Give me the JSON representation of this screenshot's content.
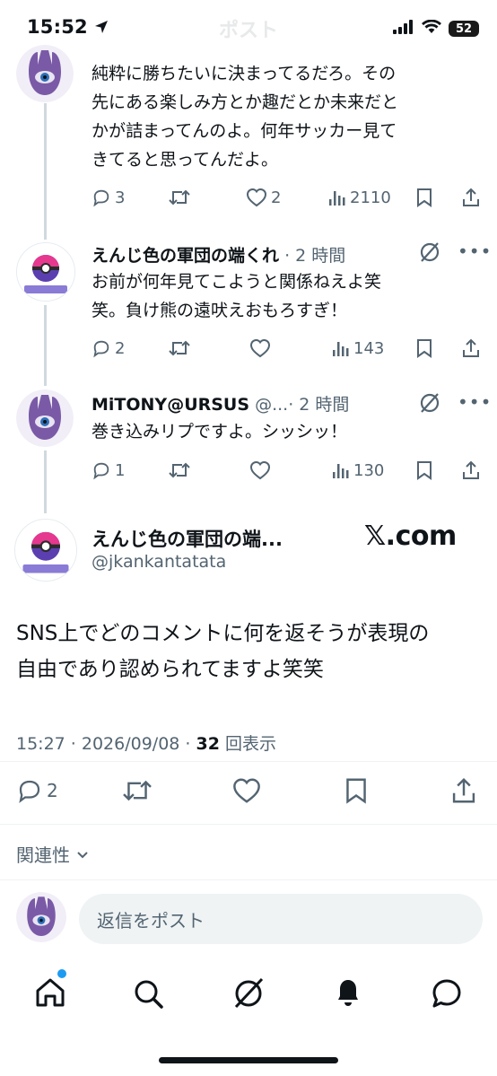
{
  "status_bar": {
    "time": "15:52",
    "battery": "52",
    "title": "ポスト"
  },
  "colors": {
    "accent": "#1d9bf0",
    "muted": "#536471",
    "line": "#cfd9de"
  },
  "tweets": [
    {
      "text_lines": [
        "純粋に勝ちたいに決まってるだろ。その",
        "先にある楽しみ方とか趣だとか未来だと",
        "かが詰まってんのよ。何年サッカー見て",
        "きてると思ってんだよ。"
      ],
      "replies": "3",
      "reposts": "",
      "likes": "2",
      "views": "2110"
    },
    {
      "name": "えんじ色の軍団の端くれ",
      "meta": "· 2 時間",
      "text_lines": [
        "お前が何年見てこようと関係ねえよ笑",
        "笑。負け熊の遠吠えおもろすぎ！"
      ],
      "replies": "2",
      "reposts": "",
      "likes": "",
      "views": "143"
    },
    {
      "name": "MiTONY@URSUS",
      "handle": "@...",
      "meta": "· 2 時間",
      "text_lines": [
        "巻き込みリプですよ。シッシッ！"
      ],
      "replies": "1",
      "reposts": "",
      "likes": "",
      "views": "130"
    }
  ],
  "main_post": {
    "name": "えんじ色の軍団の端...",
    "handle": "@jkankantatata",
    "watermark": "𝕏.com",
    "text_lines": [
      "SNS上でどのコメントに何を返そうが表現の",
      "自由であり認められてますよ笑笑"
    ],
    "time": "15:27 · 2026/09/08 ·",
    "views_count": "32",
    "views_label": "回表示",
    "replies": "2"
  },
  "sort": {
    "label": "関連性"
  },
  "reply": {
    "placeholder": "返信をポスト"
  },
  "nav": {
    "items": [
      "home",
      "search",
      "grok",
      "notifications",
      "messages"
    ]
  }
}
